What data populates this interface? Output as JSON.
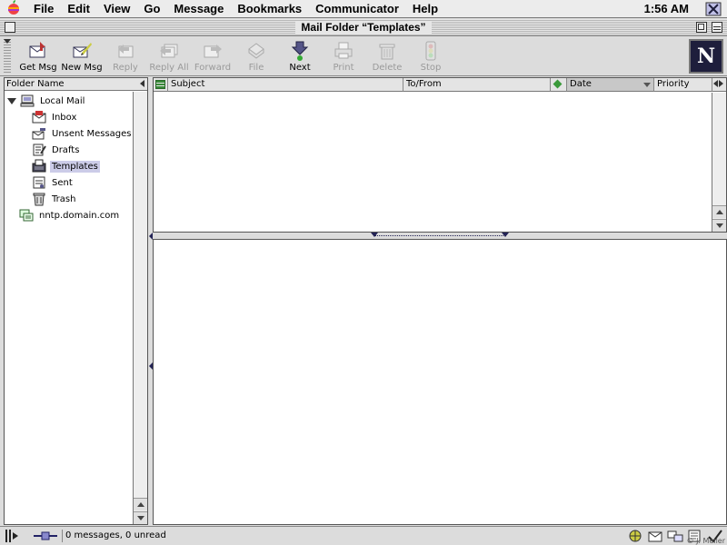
{
  "menubar": {
    "items": [
      "File",
      "Edit",
      "View",
      "Go",
      "Message",
      "Bookmarks",
      "Communicator",
      "Help"
    ],
    "clock": "1:56 AM"
  },
  "window": {
    "title": "Mail Folder “Templates”"
  },
  "toolbar": {
    "buttons": [
      {
        "label": "Get Msg",
        "icon": "get-msg-icon",
        "enabled": true
      },
      {
        "label": "New Msg",
        "icon": "new-msg-icon",
        "enabled": true
      },
      {
        "label": "Reply",
        "icon": "reply-icon",
        "enabled": false
      },
      {
        "label": "Reply All",
        "icon": "reply-all-icon",
        "enabled": false
      },
      {
        "label": "Forward",
        "icon": "forward-icon",
        "enabled": false
      },
      {
        "label": "File",
        "icon": "file-icon",
        "enabled": false
      },
      {
        "label": "Next",
        "icon": "next-icon",
        "enabled": true
      },
      {
        "label": "Print",
        "icon": "print-icon",
        "enabled": false
      },
      {
        "label": "Delete",
        "icon": "delete-icon",
        "enabled": false
      },
      {
        "label": "Stop",
        "icon": "stop-icon",
        "enabled": false
      }
    ],
    "logo_letter": "N"
  },
  "folder_pane": {
    "header": "Folder Name",
    "items": [
      {
        "label": "Local Mail",
        "icon": "computer-icon",
        "selected": false
      },
      {
        "label": "Inbox",
        "icon": "inbox-icon",
        "selected": false
      },
      {
        "label": "Unsent Messages",
        "icon": "unsent-icon",
        "selected": false
      },
      {
        "label": "Drafts",
        "icon": "drafts-icon",
        "selected": false
      },
      {
        "label": "Templates",
        "icon": "templates-icon",
        "selected": true
      },
      {
        "label": "Sent",
        "icon": "sent-icon",
        "selected": false
      },
      {
        "label": "Trash",
        "icon": "trash-icon",
        "selected": false
      },
      {
        "label": "nntp.domain.com",
        "icon": "news-server-icon",
        "selected": false
      }
    ]
  },
  "message_list": {
    "columns": [
      "Subject",
      "To/From",
      "Date",
      "Priority"
    ],
    "sorted_column": "Date",
    "rows": []
  },
  "statusbar": {
    "text": "0 messages, 0 unread",
    "copyright": "© J. Meller"
  },
  "colors": {
    "selection": "#cccce8",
    "chrome": "#dcdcdc",
    "thread_green": "#3a8a3a"
  }
}
